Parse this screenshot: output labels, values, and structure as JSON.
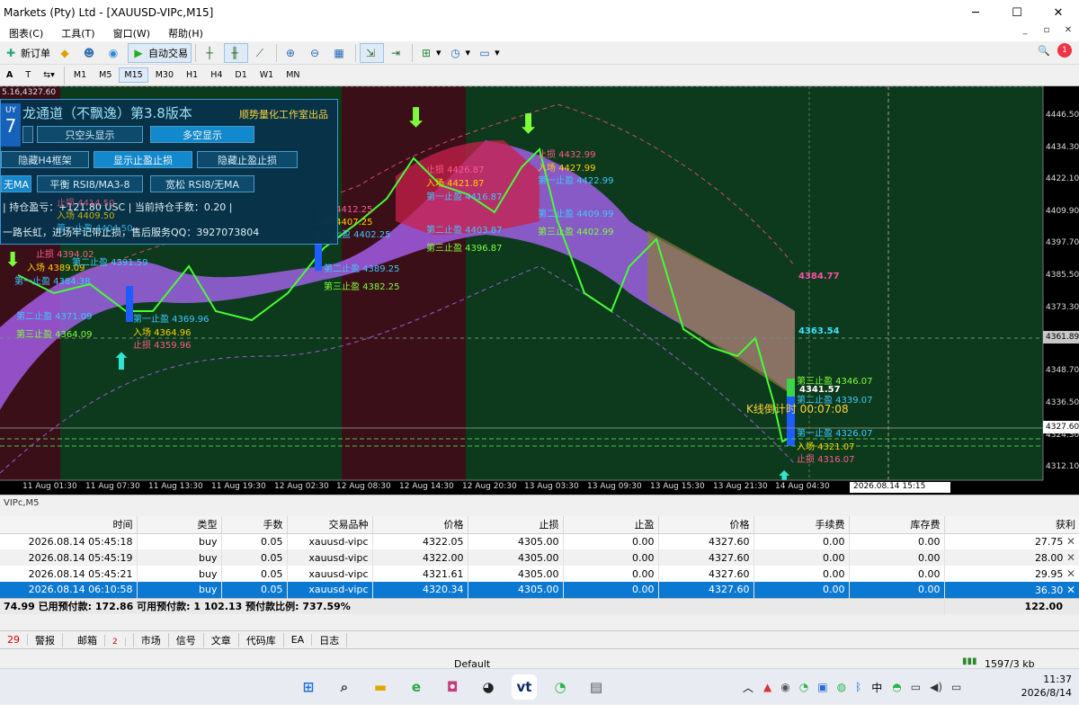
{
  "window": {
    "title": "Markets (Pty) Ltd - [XAUUSD-VIPc,M15]",
    "controls": [
      "─",
      "☐",
      "✕"
    ]
  },
  "menu": {
    "items": [
      "图表(C)",
      "工具(T)",
      "窗口(W)",
      "帮助(H)"
    ],
    "right_controls": [
      "_",
      "▫",
      "✕"
    ]
  },
  "toolbar": {
    "new_order": "新订单",
    "auto_trade": "自动交易"
  },
  "timeframes": [
    "M1",
    "M5",
    "M15",
    "M30",
    "H1",
    "H4",
    "D1",
    "W1",
    "MN"
  ],
  "active_timeframe": "M15",
  "panel": {
    "title": "龙通道（不飘逸）第3.8版本",
    "subtitle": "顺势量化工作室出品",
    "buy_badge": "UY",
    "buy_number": "7",
    "btn_short_only": "只空头显示",
    "btn_long_show": "多空显示",
    "btn_hide_h4": "隐藏H4框架",
    "btn_show_sl_tp": "显示止盈止损",
    "btn_hide_sl_tp": "隐藏止盈止损",
    "btn_no_ma": "无MA",
    "btn_balance": "平衡 RSI8/MA3-8",
    "btn_loose": "宽松 RSI8/无MA",
    "info_line": "| 持仓盈亏：+121.80 USC | 当前持仓手数：0.20 |",
    "service_line": "一路长虹，进场牢记带止损，售后服务QQ：3927073804"
  },
  "price_axis": [
    "4446.50",
    "4434.30",
    "4422.10",
    "4409.90",
    "4397.70",
    "4385.50",
    "4373.30",
    "4361.89",
    "4348.70",
    "4336.50",
    "4327.60",
    "4324.30",
    "4312.10"
  ],
  "price_highlights": {
    "current": "4361.89",
    "ask": "4327.60",
    "upper_band": "4384.77",
    "mid_band": "4363.54"
  },
  "time_axis": [
    "11 Aug 01:30",
    "11 Aug 07:30",
    "11 Aug 13:30",
    "11 Aug 19:30",
    "12 Aug 02:30",
    "12 Aug 08:30",
    "12 Aug 14:30",
    "12 Aug 20:30",
    "13 Aug 03:30",
    "13 Aug 09:30",
    "13 Aug 15:30",
    "13 Aug 21:30",
    "14 Aug 04:30"
  ],
  "cursor_time": "2026.08.14 15:15",
  "countdown": "K线倒计时 00:07:08",
  "header_price": "5.16,4327.60",
  "chart_labels": [
    {
      "t": "止损 4394.02",
      "c": "#ff5a8a"
    },
    {
      "t": "入场 4389.09",
      "c": "#ffd000"
    },
    {
      "t": "第一止盈 4384.38",
      "c": "#3ec7ff"
    },
    {
      "t": "第二止盈 4371.09",
      "c": "#3ec7ff"
    },
    {
      "t": "第三止盈 4364.09",
      "c": "#7cff3a"
    },
    {
      "t": "第二止盈 4391.59",
      "c": "#3ec7ff"
    },
    {
      "t": "第一止盈 4369.96",
      "c": "#3ec7ff"
    },
    {
      "t": "入场 4364.96",
      "c": "#ffd000"
    },
    {
      "t": "止损 4359.96",
      "c": "#ff5a8a"
    },
    {
      "t": "止损 4414.50",
      "c": "#ff5a8a"
    },
    {
      "t": "入场 4409.50",
      "c": "#ffd000"
    },
    {
      "t": "第一止盈 4404.50",
      "c": "#3ec7ff"
    },
    {
      "t": "止损 4412.25",
      "c": "#ff5a8a"
    },
    {
      "t": "入场 4407.25",
      "c": "#ffd000"
    },
    {
      "t": "第一止盈 4402.25",
      "c": "#3ec7ff"
    },
    {
      "t": "第二止盈 4389.25",
      "c": "#3ec7ff"
    },
    {
      "t": "第三止盈 4382.25",
      "c": "#7cff3a"
    },
    {
      "t": "止损 4426.87",
      "c": "#ff5a8a"
    },
    {
      "t": "入场 4421.87",
      "c": "#ffd000"
    },
    {
      "t": "第一止盈 4416.87",
      "c": "#3ec7ff"
    },
    {
      "t": "第二止盈 4403.87",
      "c": "#3ec7ff"
    },
    {
      "t": "第三止盈 4396.87",
      "c": "#7cff3a"
    },
    {
      "t": "止损 4432.99",
      "c": "#ff5a8a"
    },
    {
      "t": "入场 4427.99",
      "c": "#ffd000"
    },
    {
      "t": "第一止盈 4422.99",
      "c": "#3ec7ff"
    },
    {
      "t": "第二止盈 4409.99",
      "c": "#3ec7ff"
    },
    {
      "t": "第三止盈 4402.99",
      "c": "#7cff3a"
    },
    {
      "t": "第三止盈 4346.07",
      "c": "#7cff3a"
    },
    {
      "t": "4341.57",
      "c": "#ffffff"
    },
    {
      "t": "第二止盈 4339.07",
      "c": "#3ec7ff"
    },
    {
      "t": "第一止盈 4326.07",
      "c": "#3ec7ff"
    },
    {
      "t": "入场 4321.07",
      "c": "#ffd000"
    },
    {
      "t": "止损 4316.07",
      "c": "#ff5a8a"
    }
  ],
  "chart_tab": "VIPc,M5",
  "trades": {
    "headers": [
      "时间",
      "类型",
      "手数",
      "交易品种",
      "价格",
      "止损",
      "止盈",
      "价格",
      "手续费",
      "库存费",
      "获利"
    ],
    "rows": [
      [
        "2026.08.14 05:45:18",
        "buy",
        "0.05",
        "xauusd-vipc",
        "4322.05",
        "4305.00",
        "0.00",
        "4327.60",
        "0.00",
        "0.00",
        "27.75"
      ],
      [
        "2026.08.14 05:45:19",
        "buy",
        "0.05",
        "xauusd-vipc",
        "4322.00",
        "4305.00",
        "0.00",
        "4327.60",
        "0.00",
        "0.00",
        "28.00"
      ],
      [
        "2026.08.14 05:45:21",
        "buy",
        "0.05",
        "xauusd-vipc",
        "4321.61",
        "4305.00",
        "0.00",
        "4327.60",
        "0.00",
        "0.00",
        "29.95"
      ],
      [
        "2026.08.14 06:10:58",
        "buy",
        "0.05",
        "xauusd-vipc",
        "4320.34",
        "4305.00",
        "0.00",
        "4327.60",
        "0.00",
        "0.00",
        "36.30"
      ]
    ],
    "summary": "74.99  已用预付款: 172.86  可用预付款: 1 102.13  预付款比例: 737.59%",
    "summary_total": "122.00"
  },
  "terminal_tabs": [
    {
      "label": "29",
      "red": true
    },
    {
      "label": "警报"
    },
    {
      "label": "邮箱",
      "badge": "2"
    },
    {
      "label": "市场"
    },
    {
      "label": "信号"
    },
    {
      "label": "文章"
    },
    {
      "label": "代码库"
    },
    {
      "label": "EA"
    },
    {
      "label": "日志"
    }
  ],
  "status": {
    "profile": "Default",
    "traffic": "1597/3 kb"
  },
  "taskbar": {
    "ime": "中",
    "time": "11:37",
    "date": "2026/8/14"
  }
}
